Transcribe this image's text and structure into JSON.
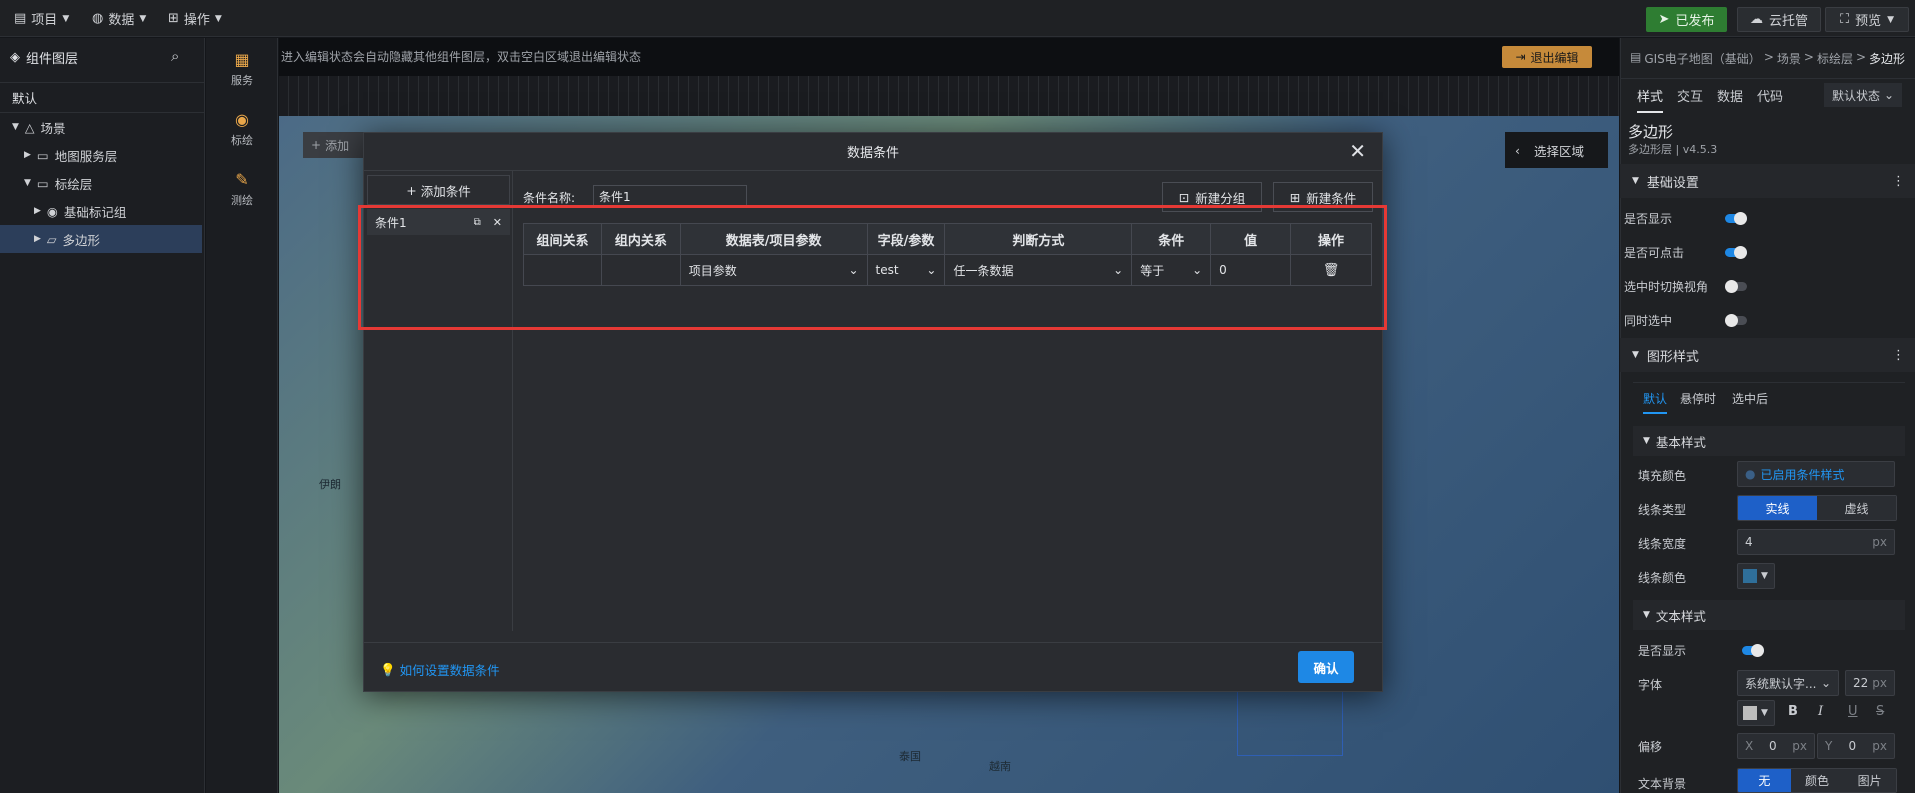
{
  "topbar": {
    "menus": [
      {
        "label": "项目",
        "icon": "document-icon"
      },
      {
        "label": "数据",
        "icon": "database-icon"
      },
      {
        "label": "操作",
        "icon": "grid-icon"
      }
    ],
    "published_label": "已发布",
    "cloud_label": "云托管",
    "preview_label": "预览"
  },
  "left_panel": {
    "title": "组件图层",
    "tab": "默认",
    "tree": [
      {
        "label": "场景",
        "level": 0
      },
      {
        "label": "地图服务层",
        "level": 1
      },
      {
        "label": "标绘层",
        "level": 1
      },
      {
        "label": "基础标记组",
        "level": 2
      },
      {
        "label": "多边形",
        "level": 2
      }
    ]
  },
  "icon_strip": [
    {
      "label": "服务",
      "icon": "map-icon"
    },
    {
      "label": "标绘",
      "icon": "marker-icon"
    },
    {
      "label": "测绘",
      "icon": "measure-icon"
    }
  ],
  "canvas": {
    "notice": "进入编辑状态会自动隐藏其他组件图层，双击空白区域退出编辑状态",
    "exit_edit_label": "退出编辑",
    "add_label": "添加",
    "select_area_label": "选择区域"
  },
  "map_labels": [
    {
      "text": "伊朗"
    },
    {
      "text": "泰国"
    },
    {
      "text": "越南"
    }
  ],
  "modal": {
    "title": "数据条件",
    "add_condition_label": "添加条件",
    "conditions": [
      {
        "name": "条件1"
      }
    ],
    "name_label": "条件名称:",
    "name_value": "条件1",
    "new_group_label": "新建分组",
    "new_condition_label": "新建条件",
    "table": {
      "headers": [
        "组间关系",
        "组内关系",
        "数据表/项目参数",
        "字段/参数",
        "判断方式",
        "条件",
        "值",
        "操作"
      ],
      "rows": [
        {
          "group_rel": "",
          "inner_rel": "",
          "source": "项目参数",
          "field": "test",
          "judge": "任一条数据",
          "cond": "等于",
          "value": "0"
        }
      ]
    },
    "help_link": "如何设置数据条件",
    "confirm_label": "确认"
  },
  "right_panel": {
    "breadcrumb": [
      "GIS电子地图（基础）",
      "场景",
      "标绘层",
      "多边形"
    ],
    "tabs": [
      "样式",
      "交互",
      "数据",
      "代码"
    ],
    "state_select": "默认状态",
    "component_title": "多边形",
    "component_version": "多边形层 | v4.5.3",
    "basic_settings": {
      "title": "基础设置",
      "rows": [
        {
          "label": "是否显示",
          "on": true
        },
        {
          "label": "是否可点击",
          "on": true
        },
        {
          "label": "选中时切换视角",
          "on": false
        },
        {
          "label": "同时选中",
          "on": false
        }
      ]
    },
    "shape_style": {
      "title": "图形样式",
      "state_tabs": [
        "默认",
        "悬停时",
        "选中后"
      ],
      "basic_style_title": "基本样式",
      "fill_color_label": "填充颜色",
      "fill_color_value": "已启用条件样式",
      "line_type_label": "线条类型",
      "line_types": [
        "实线",
        "虚线"
      ],
      "line_width_label": "线条宽度",
      "line_width_value": "4",
      "line_width_unit": "px",
      "line_color_label": "线条颜色",
      "line_color": "#2f6f9a"
    },
    "text_style": {
      "title": "文本样式",
      "show_label": "是否显示",
      "font_label": "字体",
      "font_value": "系统默认字...",
      "font_size": "22",
      "font_size_unit": "px",
      "offset_label": "偏移",
      "offset_x_label": "X",
      "offset_x": "0",
      "offset_y_label": "Y",
      "offset_y": "0",
      "offset_unit": "px",
      "bg_label": "文本背景",
      "bg_options": [
        "无",
        "颜色",
        "图片"
      ]
    }
  },
  "colors": {
    "accent": "#1e88e5",
    "highlight_box": "#e53935",
    "published_green": "#2e7d32",
    "exit_edit_orange": "#c68a3a"
  }
}
